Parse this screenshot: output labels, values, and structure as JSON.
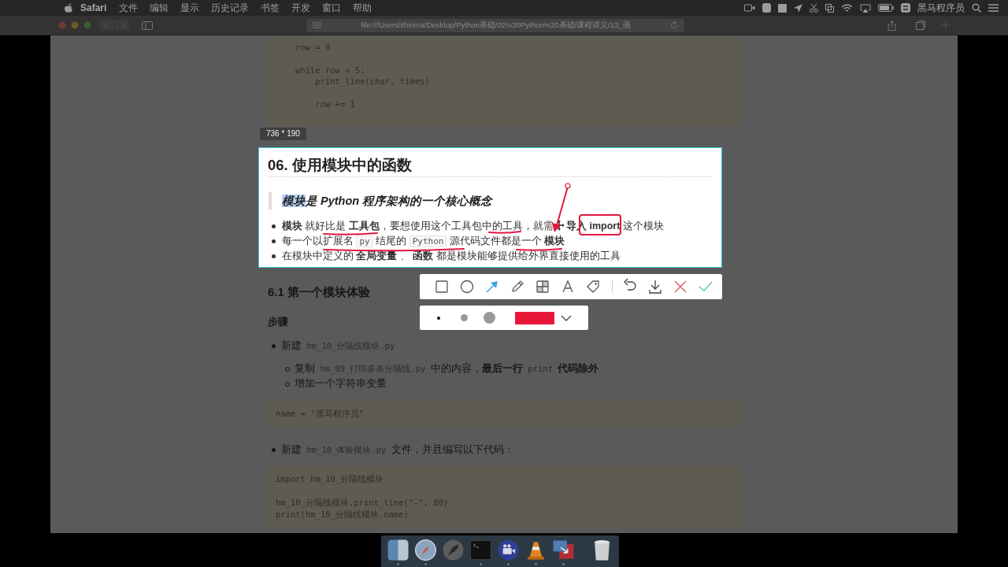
{
  "menu_bar": {
    "app": "Safari",
    "menus": [
      "文件",
      "编辑",
      "显示",
      "历史记录",
      "书签",
      "开发",
      "窗口",
      "帮助"
    ],
    "user": "黑马程序员"
  },
  "browser": {
    "url": "file:///Users/itheima/Desktop/Python基础/02%20Python%20基础/课程讲义/13_函"
  },
  "article": {
    "top_code": "row = 0\n\nwhile row < 5:\n    print_line(char, times)\n\n    row += 1",
    "selected_section": {
      "heading": "06. 使用模块中的函数",
      "quote": {
        "selected": "模块",
        "rest": "是 Python 程序架构的一个核心概念"
      },
      "items": [
        [
          {
            "kind": "bold",
            "t": "模块"
          },
          {
            "kind": "plain",
            "t": " 就好比是 "
          },
          {
            "kind": "bold",
            "t": "工具包"
          },
          {
            "kind": "plain",
            "t": "，要想使用这个工具包中的工具，就需"
          },
          {
            "kind": "cursor"
          },
          {
            "kind": "bold",
            "t": "导入 import"
          },
          {
            "kind": "plain",
            "t": " 这个模块"
          }
        ],
        [
          {
            "kind": "plain",
            "t": "每一个以扩展名 "
          },
          {
            "kind": "code",
            "t": "py"
          },
          {
            "kind": "plain",
            "t": " 结尾的 "
          },
          {
            "kind": "code",
            "t": "Python"
          },
          {
            "kind": "plain",
            "t": " 源代码文件都是一个 "
          },
          {
            "kind": "bold",
            "t": "模块"
          }
        ],
        [
          {
            "kind": "plain",
            "t": "在模块中定义的 "
          },
          {
            "kind": "bold",
            "t": "全局变量"
          },
          {
            "kind": "plain",
            "t": " 、 "
          },
          {
            "kind": "bold",
            "t": "函数"
          },
          {
            "kind": "plain",
            "t": " 都是模块能够提供给外界直接使用的工具"
          }
        ]
      ]
    },
    "subheading": "6.1 第一个模块体验",
    "steps_label": "步骤",
    "blocks": [
      {
        "kind": "list",
        "segments": [
          {
            "kind": "plain",
            "t": "新建 "
          },
          {
            "kind": "code",
            "t": "hm_10_分隔线模块.py"
          }
        ],
        "children": [
          [
            {
              "kind": "plain",
              "t": "复制 "
            },
            {
              "kind": "code",
              "t": "hm_09_打印多条分隔线.py"
            },
            {
              "kind": "plain",
              "t": " 中的内容，"
            },
            {
              "kind": "bold",
              "t": "最后一行 "
            },
            {
              "kind": "code",
              "t": "print"
            },
            {
              "kind": "bold",
              "t": " 代码除外"
            }
          ],
          [
            {
              "kind": "plain",
              "t": "增加一个字符串变量"
            }
          ]
        ]
      },
      {
        "kind": "code",
        "text": "name = \"黑马程序员\""
      },
      {
        "kind": "list",
        "segments": [
          {
            "kind": "plain",
            "t": "新建 "
          },
          {
            "kind": "code",
            "t": "hm_10_体验模块.py"
          },
          {
            "kind": "plain",
            "t": " 文件，并且编写以下代码："
          }
        ]
      },
      {
        "kind": "code",
        "text": "import hm_10_分隔线模块\n\nhm_10_分隔线模块.print_line(\"-\", 80)\nprint(hm_10_分隔线模块.name)"
      }
    ]
  },
  "capture": {
    "size_label": "736 * 190",
    "tools": [
      {
        "kind": "rect",
        "selected": false
      },
      {
        "kind": "circle",
        "selected": false
      },
      {
        "kind": "arrow",
        "selected": true
      },
      {
        "kind": "pen",
        "selected": false
      },
      {
        "kind": "mosaic",
        "selected": false
      },
      {
        "kind": "text",
        "selected": false
      },
      {
        "kind": "tag",
        "selected": false
      }
    ],
    "actions": [
      {
        "kind": "undo"
      },
      {
        "kind": "download"
      },
      {
        "kind": "cancel"
      },
      {
        "kind": "confirm"
      }
    ],
    "sizes": [
      {
        "kind": "small",
        "selected": true
      },
      {
        "kind": "medium",
        "selected": false
      },
      {
        "kind": "large",
        "selected": false
      }
    ],
    "color": "#e8173a"
  },
  "dock": [
    {
      "kind": "finder",
      "running": true
    },
    {
      "kind": "safari",
      "running": true
    },
    {
      "kind": "launchpad",
      "running": false
    },
    {
      "kind": "terminal",
      "running": true
    },
    {
      "kind": "video",
      "running": true
    },
    {
      "kind": "cone",
      "running": true
    },
    {
      "kind": "app",
      "running": true
    },
    {
      "kind": "trash",
      "running": false
    }
  ]
}
